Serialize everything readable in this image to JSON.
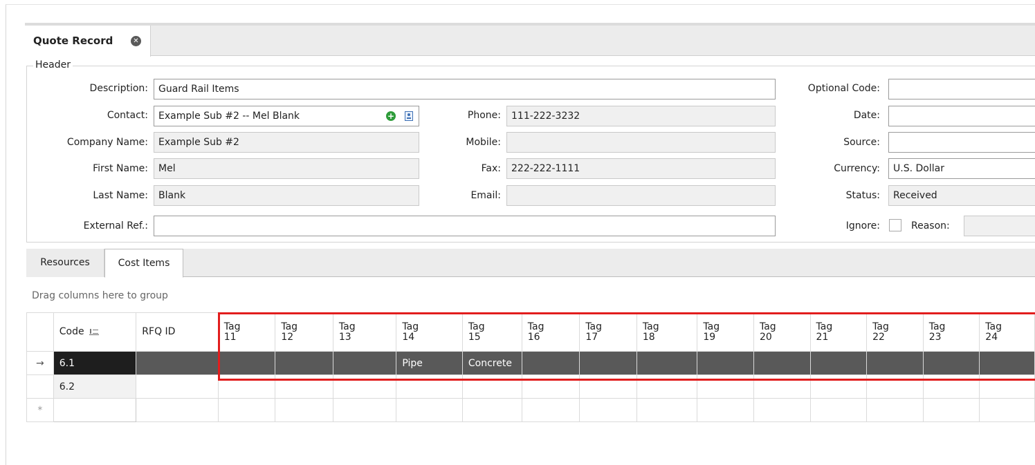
{
  "document_tab": {
    "label": "Quote Record",
    "close_icon": "close-circle-icon"
  },
  "header": {
    "group_label": "Header",
    "description": {
      "label": "Description:",
      "value": "Guard Rail Items"
    },
    "contact": {
      "label": "Contact:",
      "value": "Example Sub #2 -- Mel Blank",
      "add_icon": "plus-circle-icon",
      "card_icon": "contact-card-icon"
    },
    "company_name": {
      "label": "Company Name:",
      "value": "Example Sub #2"
    },
    "first_name": {
      "label": "First Name:",
      "value": "Mel"
    },
    "last_name": {
      "label": "Last Name:",
      "value": "Blank"
    },
    "external_ref": {
      "label": "External Ref.:",
      "value": ""
    },
    "phone": {
      "label": "Phone:",
      "value": "111-222-3232"
    },
    "mobile": {
      "label": "Mobile:",
      "value": ""
    },
    "fax": {
      "label": "Fax:",
      "value": "222-222-1111"
    },
    "email": {
      "label": "Email:",
      "value": ""
    },
    "optional_code": {
      "label": "Optional Code:",
      "value": ""
    },
    "date": {
      "label": "Date:",
      "value": ""
    },
    "source": {
      "label": "Source:",
      "value": ""
    },
    "currency": {
      "label": "Currency:",
      "value": "U.S. Dollar"
    },
    "status": {
      "label": "Status:",
      "value": "Received"
    },
    "ignore": {
      "label": "Ignore:",
      "checked": false
    },
    "reason": {
      "label": "Reason:",
      "value": ""
    }
  },
  "subtabs": [
    {
      "label": "Resources",
      "active": false
    },
    {
      "label": "Cost Items",
      "active": true
    }
  ],
  "grid": {
    "group_hint": "Drag columns here to group",
    "columns": {
      "code": "Code",
      "rfq_id": "RFQ ID",
      "tags": [
        [
          "Tag",
          "11"
        ],
        [
          "Tag",
          "12"
        ],
        [
          "Tag",
          "13"
        ],
        [
          "Tag",
          "14"
        ],
        [
          "Tag",
          "15"
        ],
        [
          "Tag",
          "16"
        ],
        [
          "Tag",
          "17"
        ],
        [
          "Tag",
          "18"
        ],
        [
          "Tag",
          "19"
        ],
        [
          "Tag",
          "20"
        ],
        [
          "Tag",
          "21"
        ],
        [
          "Tag",
          "22"
        ],
        [
          "Tag",
          "23"
        ],
        [
          "Tag",
          "24"
        ]
      ]
    },
    "rows": [
      {
        "indicator": "→",
        "code": "6.1",
        "rfq_id": "",
        "tags": [
          "",
          "",
          "",
          "Pipe",
          "Concrete",
          "",
          "",
          "",
          "",
          "",
          "",
          "",
          "",
          ""
        ],
        "selected": true
      },
      {
        "indicator": "",
        "code": "6.2",
        "rfq_id": "",
        "tags": [
          "",
          "",
          "",
          "",
          "",
          "",
          "",
          "",
          "",
          "",
          "",
          "",
          "",
          ""
        ],
        "selected": false
      },
      {
        "indicator": "*",
        "code": "",
        "rfq_id": "",
        "tags": [
          "",
          "",
          "",
          "",
          "",
          "",
          "",
          "",
          "",
          "",
          "",
          "",
          "",
          ""
        ],
        "selected": false
      }
    ],
    "sort_icon": "sort-ascending-icon",
    "highlight_color": "#e21d1d"
  }
}
